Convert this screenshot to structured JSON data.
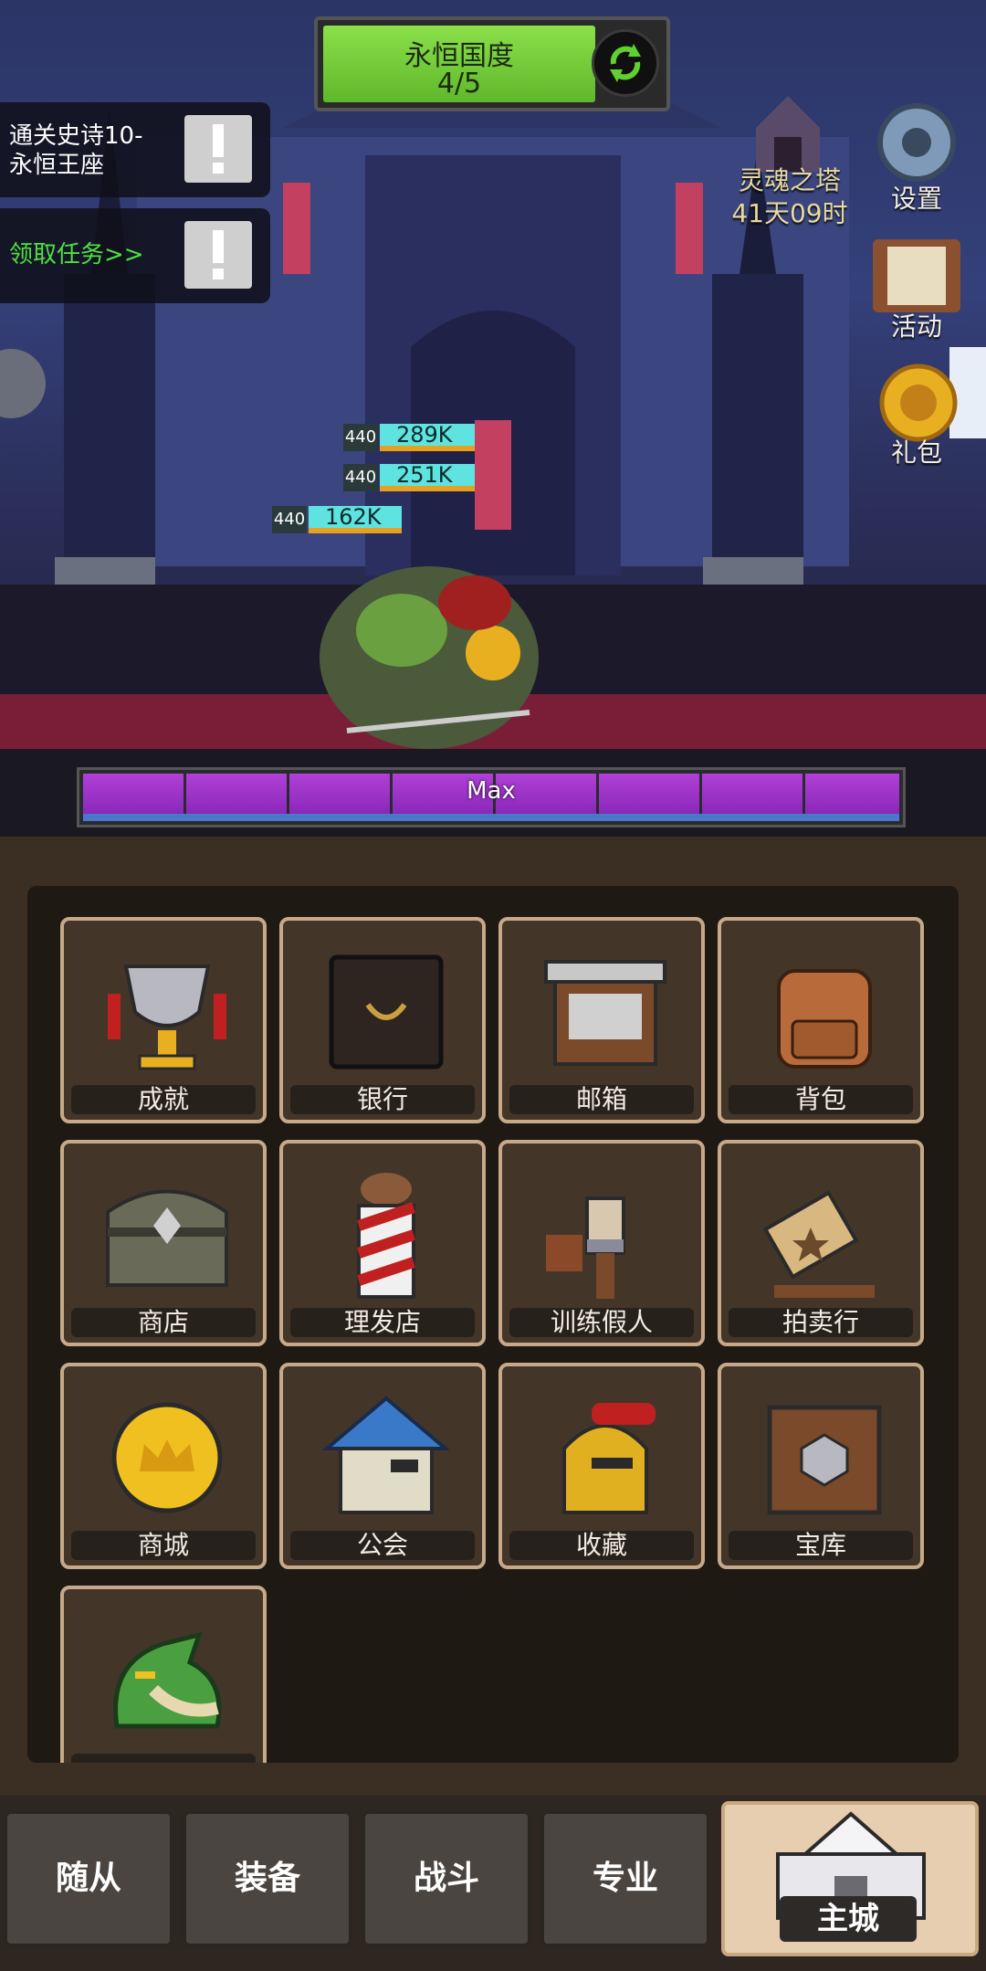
{
  "stage": {
    "name": "永恒国度",
    "progress": "4/5"
  },
  "quests": [
    {
      "line1": "通关史诗10-",
      "line2": "永恒王座"
    },
    {
      "line1": "领取任务>>",
      "line2": ""
    }
  ],
  "side": {
    "tower_name": "灵魂之塔",
    "tower_timer": "41天09时",
    "settings": "设置",
    "activity": "活动",
    "gift": "礼包"
  },
  "damage": [
    {
      "level": "440",
      "value": "289K"
    },
    {
      "level": "440",
      "value": "251K"
    },
    {
      "level": "440",
      "value": "162K"
    }
  ],
  "xp": {
    "label": "Max",
    "fill": 1.0
  },
  "menu": [
    {
      "label": "成就",
      "icon": "trophy-icon"
    },
    {
      "label": "银行",
      "icon": "safe-icon"
    },
    {
      "label": "邮箱",
      "icon": "mailbox-icon"
    },
    {
      "label": "背包",
      "icon": "backpack-icon"
    },
    {
      "label": "商店",
      "icon": "chest-icon"
    },
    {
      "label": "理发店",
      "icon": "barber-pole-icon"
    },
    {
      "label": "训练假人",
      "icon": "training-dummy-icon"
    },
    {
      "label": "拍卖行",
      "icon": "auction-hammer-icon"
    },
    {
      "label": "商城",
      "icon": "gold-coin-icon"
    },
    {
      "label": "公会",
      "icon": "guild-house-icon"
    },
    {
      "label": "收藏",
      "icon": "helmet-icon"
    },
    {
      "label": "宝库",
      "icon": "vault-icon"
    },
    {
      "label": "",
      "icon": "dragon-icon"
    }
  ],
  "nav": {
    "tabs": [
      "随从",
      "装备",
      "战斗",
      "专业",
      "主城"
    ],
    "active": "主城"
  }
}
